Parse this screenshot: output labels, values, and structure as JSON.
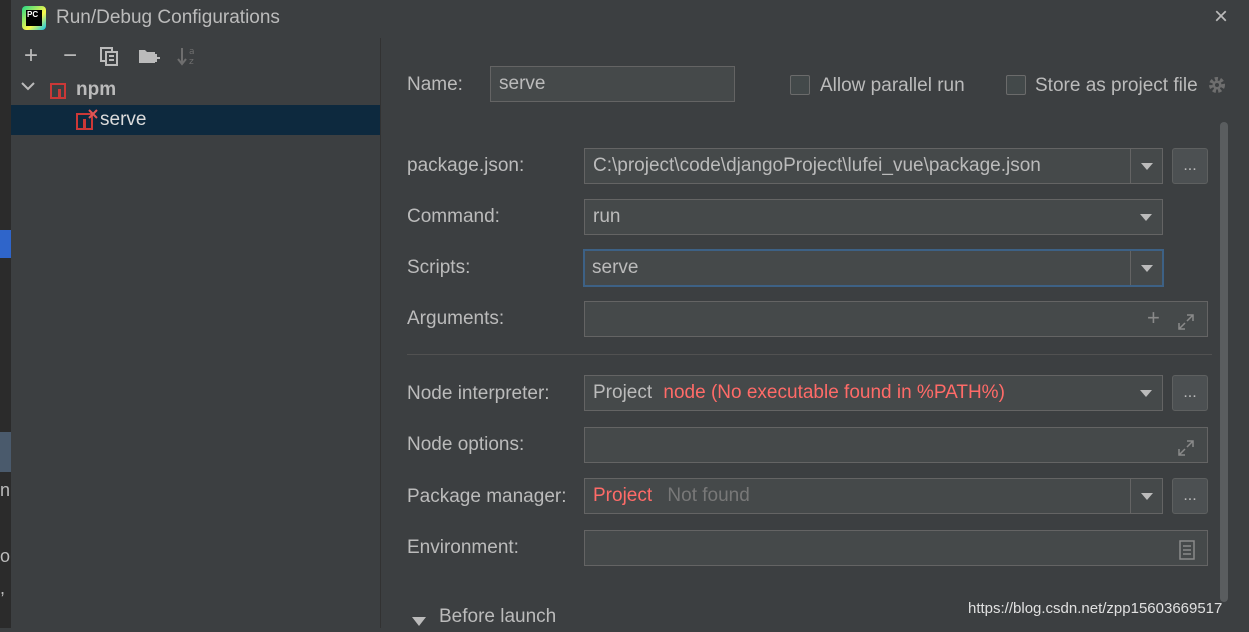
{
  "window": {
    "title": "Run/Debug Configurations",
    "app_icon": "PC",
    "close_icon": "×"
  },
  "left_strip": {
    "chars": [
      "n",
      "o",
      ","
    ]
  },
  "toolbar": {
    "add": "+",
    "remove": "−",
    "copy": "copy-icon",
    "folder": "new-folder-icon",
    "sort": "sort-icon"
  },
  "tree": {
    "group_label": "npm",
    "item_label": "serve"
  },
  "header": {
    "name_label": "Name:",
    "name_value": "serve",
    "allow_parallel_label": "Allow parallel run",
    "store_as_project_label": "Store as project file"
  },
  "form": {
    "package_json_label": "package.json:",
    "package_json_value": "C:\\project\\code\\djangoProject\\lufei_vue\\package.json",
    "command_label": "Command:",
    "command_value": "run",
    "scripts_label": "Scripts:",
    "scripts_value": "serve",
    "arguments_label": "Arguments:",
    "arguments_value": "",
    "node_interpreter_label": "Node interpreter:",
    "node_interpreter_prefix": "Project",
    "node_interpreter_error": "node (No executable found in %PATH%)",
    "node_options_label": "Node options:",
    "node_options_value": "",
    "package_manager_label": "Package manager:",
    "package_manager_prefix": "Project",
    "package_manager_value": "Not found",
    "environment_label": "Environment:",
    "environment_value": "",
    "browse_label": "...",
    "before_launch_label": "Before launch"
  },
  "watermark": "https://blog.csdn.net/zpp15603669517",
  "colors": {
    "background": "#3c3f41",
    "selection": "#0d293e",
    "error": "#ff6b68",
    "npm": "#cb3837"
  }
}
